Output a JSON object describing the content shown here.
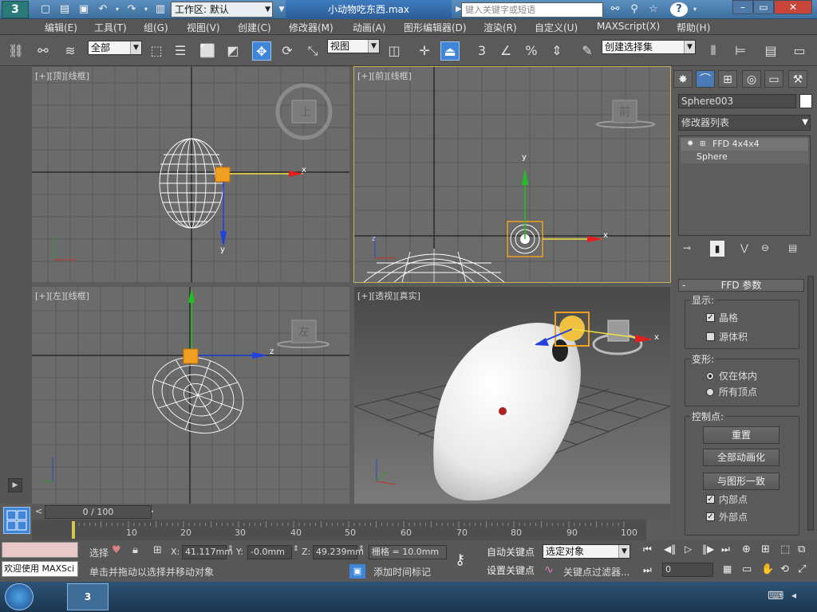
{
  "window": {
    "workspace_label": "工作区: 默认",
    "doc_title": "小动物吃东西.max",
    "search_placeholder": "键入关键字或短语",
    "buttons": {
      "minimize": "–",
      "restore": "▭",
      "close": "✕"
    }
  },
  "menu": [
    "编辑(E)",
    "工具(T)",
    "组(G)",
    "视图(V)",
    "创建(C)",
    "修改器(M)",
    "动画(A)",
    "图形编辑器(D)",
    "渲染(R)",
    "自定义(U)",
    "MAXScript(X)",
    "帮助(H)"
  ],
  "toolbar": {
    "selection_filter": "全部",
    "ref_coord": "视图",
    "named_selection": "创建选择集",
    "snap_3": "3",
    "percent_snap": "%"
  },
  "viewports": {
    "top": {
      "label": "[+][顶][线框]",
      "cube": "上",
      "axis_x": "x",
      "axis_y": "y"
    },
    "front": {
      "label": "[+][前][线框]",
      "cube": "前",
      "axis_x": "x",
      "axis_y": "y",
      "axis_z": "z"
    },
    "left": {
      "label": "[+][左][线框]",
      "cube": "左",
      "axis_z": "z",
      "axis_y": "y"
    },
    "perspective": {
      "label": "[+][透视][真实]",
      "axis_x": "x",
      "axis_z": "z"
    }
  },
  "command_panel": {
    "object_name": "Sphere003",
    "modifier_list": "修改器列表",
    "stack": [
      "FFD 4x4x4",
      "Sphere"
    ],
    "rollout_title": "FFD 参数",
    "display_group": "显示:",
    "display_lattice": "晶格",
    "display_lattice_checked": true,
    "display_source": "源体积",
    "display_source_checked": false,
    "deform_group": "变形:",
    "deform_inside": "仅在体内",
    "deform_all": "所有顶点",
    "deform_selected": "inside",
    "control_group": "控制点:",
    "btn_reset": "重置",
    "btn_animate_all": "全部动画化",
    "btn_conform": "与图形一致",
    "inside_points": "内部点",
    "inside_checked": true,
    "outside_points": "外部点",
    "outside_checked": true
  },
  "timeline": {
    "slider": "0 / 100",
    "ticks": [
      "10",
      "20",
      "30",
      "40",
      "50",
      "60",
      "70",
      "80",
      "90",
      "100"
    ]
  },
  "status": {
    "maxscript": "欢迎使用 MAXSci",
    "select_label": "选择",
    "x_label": "X:",
    "x_value": "41.117mm",
    "y_label": "Y:",
    "y_value": "-0.0mm",
    "z_label": "Z:",
    "z_value": "49.239mm",
    "grid": "栅格 = 10.0mm",
    "prompt": "单击并拖动以选择并移动对象",
    "add_time_tag": "添加时间标记",
    "auto_key": "自动关键点",
    "set_key": "设置关键点",
    "key_mode": "选定对象",
    "key_filters": "关键点过滤器...",
    "frame": "0"
  },
  "colors": {
    "viewport_bg": "#6b6b6b",
    "active_border": "#c8b25a",
    "gizmo_x": "#e02020",
    "gizmo_y": "#20c020",
    "gizmo_z": "#2040e0",
    "lattice": "#f0a020"
  }
}
